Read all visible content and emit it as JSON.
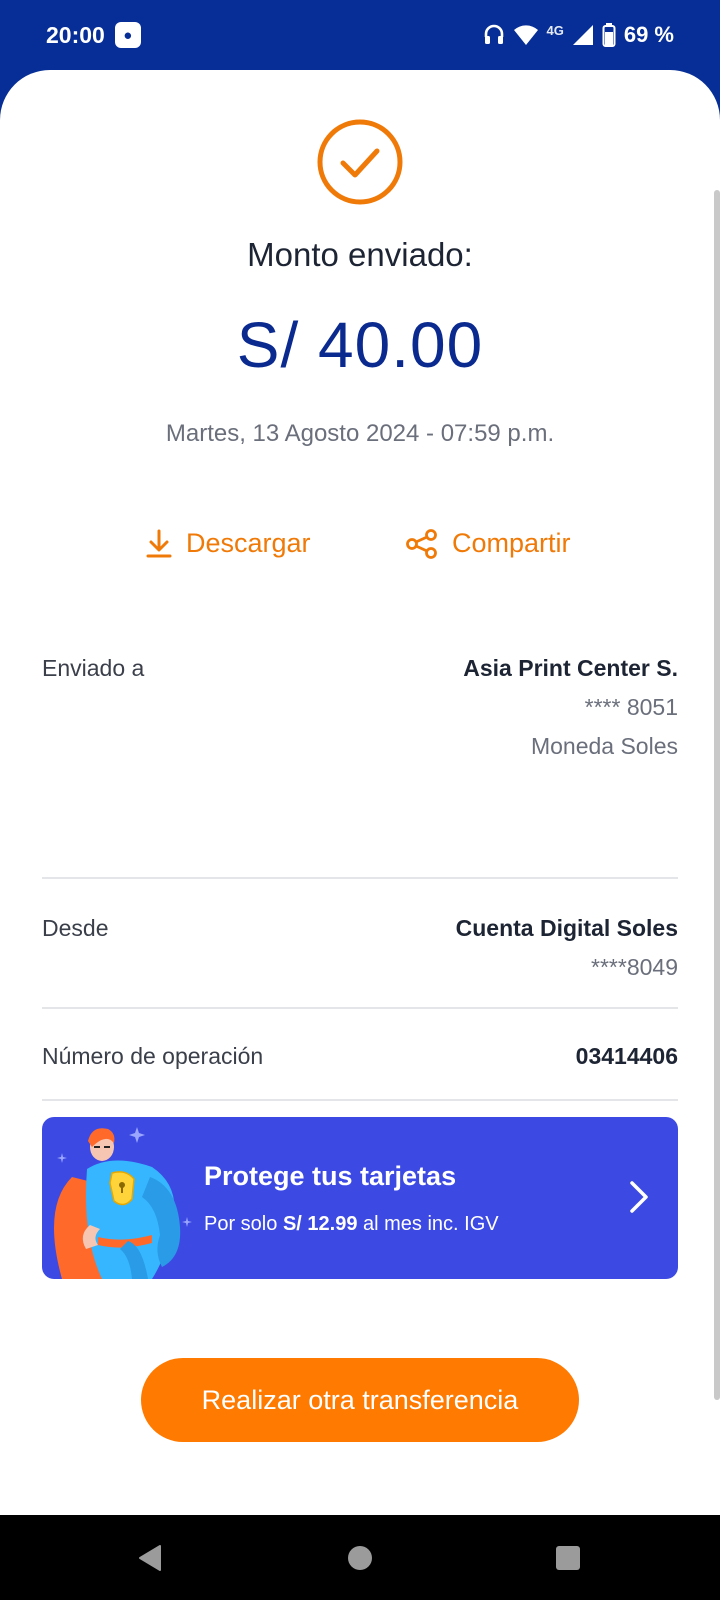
{
  "status_bar": {
    "time": "20:00",
    "network": "4G",
    "battery": "69 %"
  },
  "receipt": {
    "title": "Monto enviado:",
    "amount": "S/ 40.00",
    "datetime": "Martes, 13 Agosto 2024 - 07:59 p.m."
  },
  "actions": {
    "download_label": "Descargar",
    "share_label": "Compartir"
  },
  "details": {
    "sent_to": {
      "label": "Enviado a",
      "name": "Asia Print Center S.",
      "account": "**** 8051",
      "currency": "Moneda Soles"
    },
    "from": {
      "label": "Desde",
      "name": "Cuenta Digital Soles",
      "account": "****8049"
    },
    "operation": {
      "label": "Número de operación",
      "number": "03414406"
    }
  },
  "promo": {
    "title": "Protege tus tarjetas",
    "sub_prefix": "Por solo ",
    "sub_price": "S/ 12.99",
    "sub_suffix": " al mes inc. IGV"
  },
  "cta": {
    "label": "Realizar otra transferencia"
  },
  "colors": {
    "brand_blue": "#062e96",
    "accent_orange": "#ff7a00",
    "promo_blue": "#3c4ae3"
  }
}
